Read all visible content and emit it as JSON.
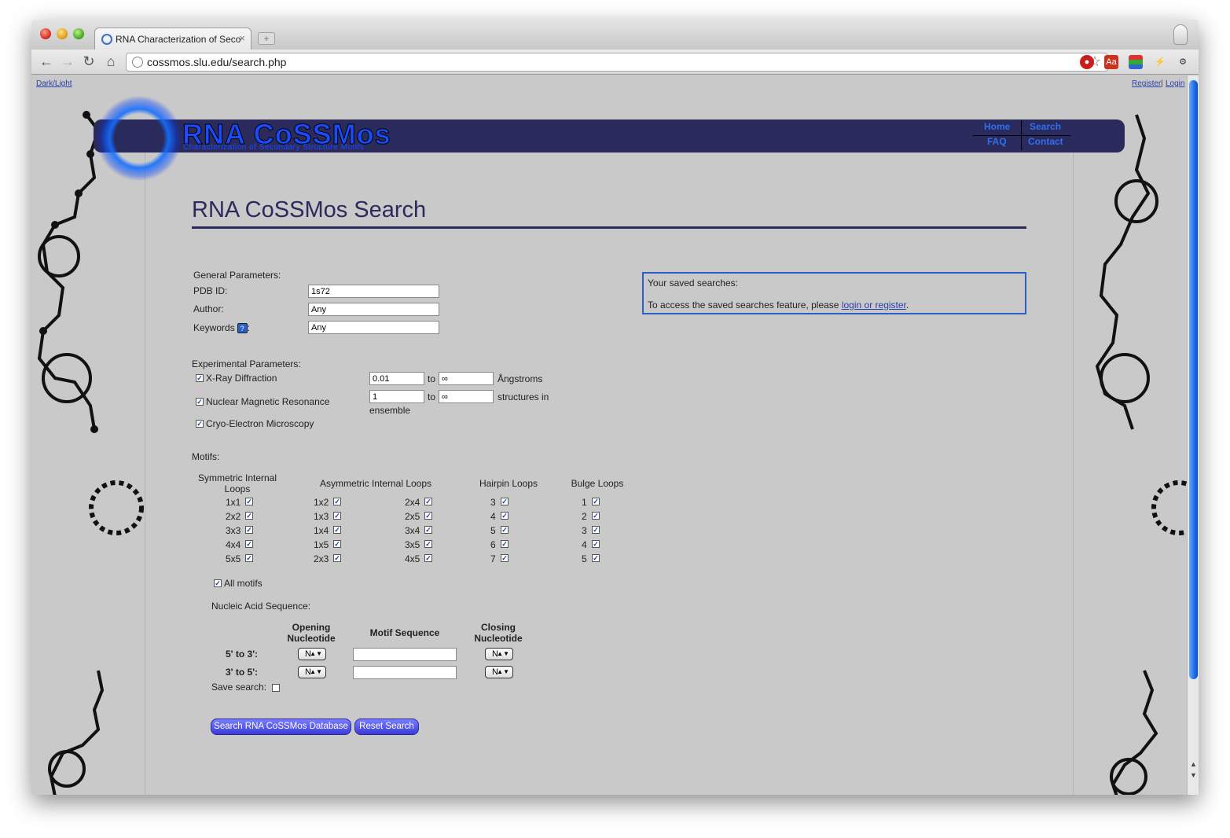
{
  "browser": {
    "tab_title": "RNA Characterization of Seco",
    "tab_close": "×",
    "new_tab": "+",
    "url": "cossmos.slu.edu/search.php",
    "back_icon": "arrow-left-icon",
    "forward_icon": "arrow-right-icon",
    "reload_icon": "reload-icon",
    "home_icon": "home-icon"
  },
  "top_links": {
    "theme": "Dark/Light",
    "register": "Register",
    "separator": "|",
    "login": "Login"
  },
  "header": {
    "logo_title": "RNA CoSSMos",
    "logo_subtitle": "Characterization of Secondary Structure Motifs",
    "nav": {
      "home": "Home",
      "search": "Search",
      "faq": "FAQ",
      "contact": "Contact"
    }
  },
  "page_title": "RNA CoSSMos Search",
  "general": {
    "heading": "General Parameters:",
    "pdb_label": "PDB ID:",
    "pdb_value": "1s72",
    "author_label": "Author:",
    "author_value": "Any",
    "keywords_label": "Keywords",
    "keywords_colon": ":",
    "keywords_value": "Any"
  },
  "experimental": {
    "heading": "Experimental Parameters:",
    "xray_label": "X-Ray Diffraction",
    "xray_min": "0.01",
    "xray_to": "to",
    "xray_max": "∞",
    "xray_unit": "Ångstroms",
    "nmr_label": "Nuclear Magnetic Resonance",
    "nmr_min": "1",
    "nmr_to": "to",
    "nmr_max": "∞",
    "nmr_unit": "structures in",
    "nmr_unit2": "ensemble",
    "cryo_label": "Cryo-Electron Microscopy"
  },
  "motifs": {
    "heading": "Motifs:",
    "sym_header_1": "Symmetric Internal",
    "sym_header_2": "Loops",
    "asym_header": "Asymmetric Internal Loops",
    "hairpin_header": "Hairpin Loops",
    "bulge_header": "Bulge Loops",
    "symmetric": [
      "1x1",
      "2x2",
      "3x3",
      "4x4",
      "5x5"
    ],
    "asymmetric_a": [
      "1x2",
      "1x3",
      "1x4",
      "1x5",
      "2x3"
    ],
    "asymmetric_b": [
      "2x4",
      "2x5",
      "3x4",
      "3x5",
      "4x5"
    ],
    "hairpin": [
      "3",
      "4",
      "5",
      "6",
      "7"
    ],
    "bulge": [
      "1",
      "2",
      "3",
      "4",
      "5"
    ],
    "all_motifs": "All motifs"
  },
  "sequence": {
    "heading": "Nucleic Acid Sequence:",
    "opening_1": "Opening",
    "opening_2": "Nucleotide",
    "motif_seq": "Motif Sequence",
    "closing_1": "Closing",
    "closing_2": "Nucleotide",
    "row1_label": "5' to 3':",
    "row2_label": "3' to 5':",
    "row1_open": "N",
    "row1_close": "N",
    "row2_open": "N",
    "row2_close": "N",
    "save_label": "Save search:"
  },
  "saved": {
    "heading": "Your saved searches:",
    "text": "To access the saved searches feature, please",
    "link": "login or register",
    "period": "."
  },
  "buttons": {
    "search": "Search RNA CoSSMos Database",
    "reset": "Reset Search"
  },
  "checked_mark": "✓"
}
